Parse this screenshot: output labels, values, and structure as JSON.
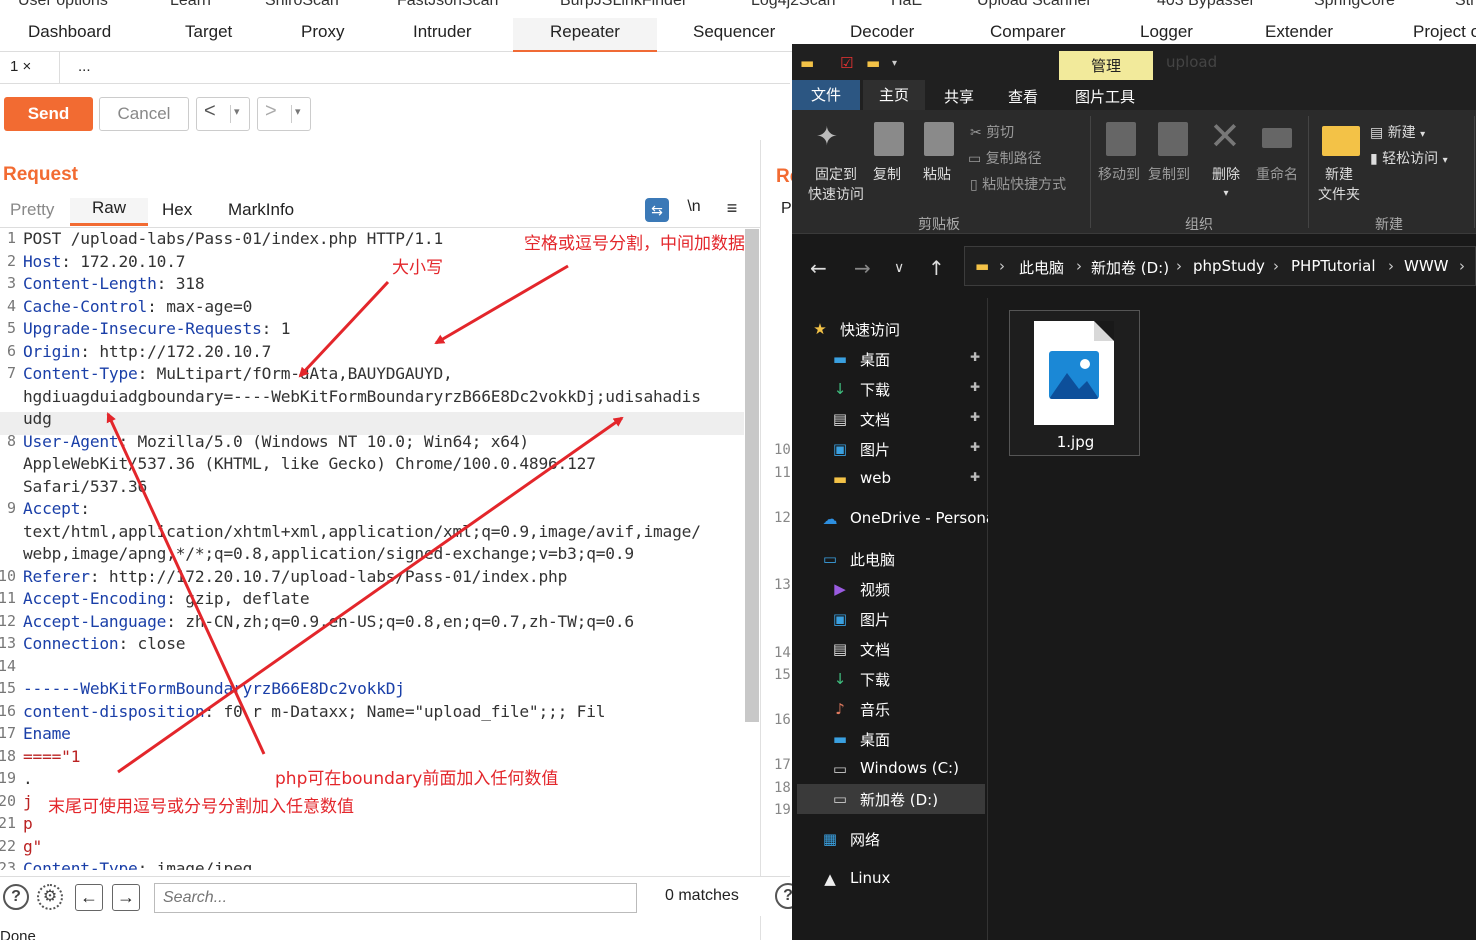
{
  "burp": {
    "top_tabs_row1": [
      "User options",
      "Learn",
      "ShiroScan",
      "FastJsonScan",
      "BurpJSLinkFinder",
      "Log4j2Scan",
      "HaE",
      "Upload Scanner",
      "403 Bypasser",
      "SpringCore",
      "Str"
    ],
    "top_tabs_row2": [
      "Dashboard",
      "Target",
      "Proxy",
      "Intruder",
      "Repeater",
      "Sequencer",
      "Decoder",
      "Comparer",
      "Logger",
      "Extender",
      "Project o"
    ],
    "active_tab": "Repeater",
    "sub_tabs": [
      "1 ×",
      "..."
    ],
    "toolbar": {
      "send": "Send",
      "cancel": "Cancel",
      "back": "<",
      "forward": ">",
      "dropdown": "▾"
    },
    "request": {
      "title": "Request",
      "tabs": [
        "Pretty",
        "Raw",
        "Hex",
        "MarkInfo"
      ],
      "active_tab": "Raw",
      "icons": [
        "wrap-icon",
        "newline-icon",
        "menu-icon"
      ],
      "newline_label": "\\n",
      "line_numbers": [
        "1",
        "2",
        "3",
        "4",
        "5",
        "6",
        "7",
        "",
        "",
        "8",
        "",
        "",
        "9",
        "",
        "",
        "10",
        "11",
        "12",
        "13",
        "14",
        "15",
        "16",
        "17",
        "18",
        "19",
        "20",
        "21",
        "22",
        "23"
      ],
      "lines": [
        {
          "k": "POST /upload-labs/Pass-01/index.php HTTP/1.1",
          "v": ""
        },
        {
          "k": "Host",
          "v": ": 172.20.10.7"
        },
        {
          "k": "Content-Length",
          "v": ": 318"
        },
        {
          "k": "Cache-Control",
          "v": ": max-age=0"
        },
        {
          "k": "Upgrade-Insecure-Requests",
          "v": ": 1"
        },
        {
          "k": "Origin",
          "v": ": http://172.20.10.7"
        },
        {
          "k": "Content-Type",
          "v": ": MuLtipart/fOrm-dAta,BAUYDGAUYD,"
        },
        {
          "k": "",
          "v": "hgdiuagduiadgboundary=----WebKitFormBoundaryrzB66E8Dc2vokkDj;udisahadis"
        },
        {
          "k": "",
          "v": "udg"
        },
        {
          "k": "User-Agent",
          "v": ": Mozilla/5.0 (Windows NT 10.0; Win64; x64)"
        },
        {
          "k": "",
          "v": "AppleWebKit/537.36 (KHTML, like Gecko) Chrome/100.0.4896.127"
        },
        {
          "k": "",
          "v": "Safari/537.36"
        },
        {
          "k": "Accept",
          "v": ":"
        },
        {
          "k": "",
          "v": "text/html,application/xhtml+xml,application/xml;q=0.9,image/avif,image/"
        },
        {
          "k": "",
          "v": "webp,image/apng,*/*;q=0.8,application/signed-exchange;v=b3;q=0.9"
        },
        {
          "k": "Referer",
          "v": ": http://172.20.10.7/upload-labs/Pass-01/index.php"
        },
        {
          "k": "Accept-Encoding",
          "v": ": gzip, deflate"
        },
        {
          "k": "Accept-Language",
          "v": ": zh-CN,zh;q=0.9,en-US;q=0.8,en;q=0.7,zh-TW;q=0.6"
        },
        {
          "k": "Connection",
          "v": ": close"
        },
        {
          "k": "",
          "v": ""
        },
        {
          "k": "------WebKitFormBoundaryrzB66E8Dc2vokkDj",
          "v": ""
        },
        {
          "k": "content-disposition",
          "v": ": f0 r m-Dataxx; Name=\"upload_file\";;; Fil"
        },
        {
          "k": "Ename",
          "v": ""
        },
        {
          "k": "====\"1",
          "v": ""
        },
        {
          "k": "",
          "v": "."
        },
        {
          "k": "j",
          "v": ""
        },
        {
          "k": "p",
          "v": ""
        },
        {
          "k": "g\"",
          "v": ""
        },
        {
          "k": "Content-Type",
          "v": ": image/jpeg"
        }
      ]
    },
    "response": {
      "title": "Re",
      "tab": "P"
    },
    "search": {
      "placeholder": "Search...",
      "matches": "0 matches"
    },
    "status": "Done",
    "annotations": {
      "a1": "空格或逗号分割，中间加数据",
      "a2": "大小写",
      "a3": "php可在boundary前面加入任何数值",
      "a4": "末尾可使用逗号或分号分割加入任意数值"
    }
  },
  "explorer": {
    "manage_tab": "管理",
    "window_title": "upload",
    "ribbon_tabs": [
      "文件",
      "主页",
      "共享",
      "查看",
      "图片工具"
    ],
    "ribbon": {
      "pin": "固定到\n快速访问",
      "pin_l1": "固定到",
      "pin_l2": "快速访问",
      "copy": "复制",
      "paste": "粘贴",
      "cut": "剪切",
      "copy_path": "复制路径",
      "paste_shortcut": "粘贴快捷方式",
      "move_to": "移动到",
      "copy_to": "复制到",
      "delete": "删除",
      "rename": "重命名",
      "new_folder_l1": "新建",
      "new_folder_l2": "文件夹",
      "new_item": "新建",
      "easy_access": "轻松访问",
      "groups": [
        "剪贴板",
        "组织",
        "新建"
      ]
    },
    "breadcrumb": [
      "此电脑",
      "新加卷 (D:)",
      "phpStudy",
      "PHPTutorial",
      "WWW"
    ],
    "nav": [
      {
        "label": "快速访问",
        "icon": "star-icon"
      },
      {
        "label": "桌面",
        "icon": "desktop-icon",
        "pin": true
      },
      {
        "label": "下载",
        "icon": "download-icon",
        "pin": true
      },
      {
        "label": "文档",
        "icon": "document-icon",
        "pin": true
      },
      {
        "label": "图片",
        "icon": "pictures-icon",
        "pin": true
      },
      {
        "label": "web",
        "icon": "folder-icon",
        "pin": true
      },
      {
        "label": "OneDrive - Persona",
        "icon": "onedrive-icon"
      },
      {
        "label": "此电脑",
        "icon": "pc-icon"
      },
      {
        "label": "视频",
        "icon": "video-icon"
      },
      {
        "label": "图片",
        "icon": "pictures-icon"
      },
      {
        "label": "文档",
        "icon": "document-icon"
      },
      {
        "label": "下载",
        "icon": "download-icon"
      },
      {
        "label": "音乐",
        "icon": "music-icon"
      },
      {
        "label": "桌面",
        "icon": "desktop-icon"
      },
      {
        "label": "Windows (C:)",
        "icon": "drive-icon"
      },
      {
        "label": "新加卷 (D:)",
        "icon": "drive-icon",
        "selected": true
      },
      {
        "label": "网络",
        "icon": "network-icon"
      },
      {
        "label": "Linux",
        "icon": "linux-icon"
      }
    ],
    "files": [
      {
        "name": "1.jpg",
        "icon": "image-file-icon"
      }
    ]
  }
}
